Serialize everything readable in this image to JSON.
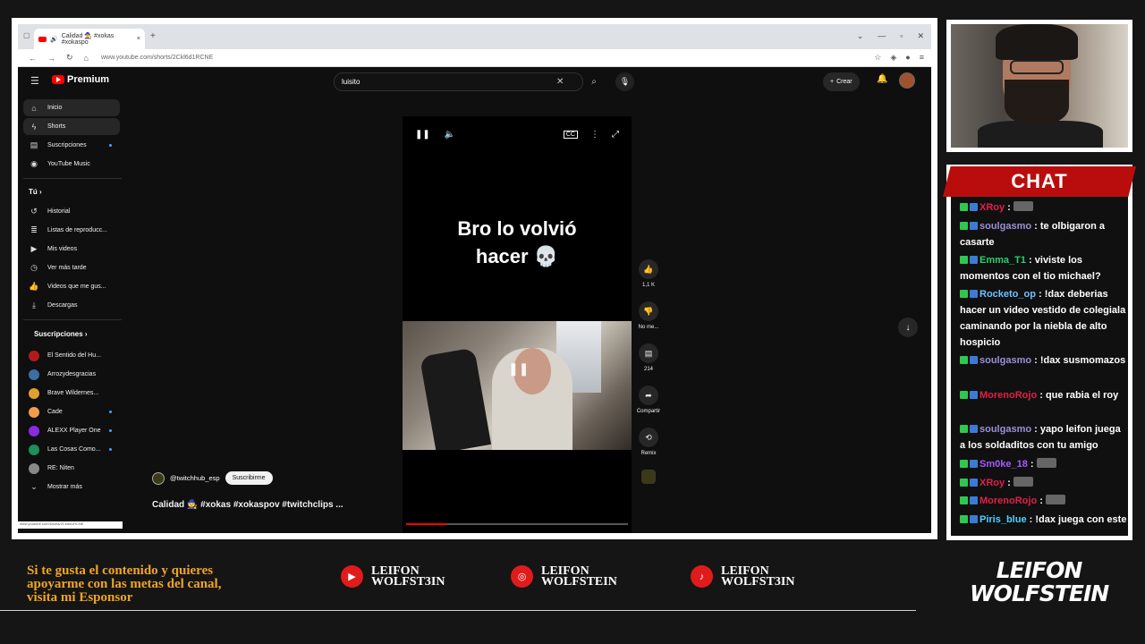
{
  "browser": {
    "tab_title": "Calidad 🧙 #xokas #xokaspo",
    "url": "www.youtube.com/shorts/2Ckl6d1RCNE",
    "close_tab": "×",
    "new_tab": "+"
  },
  "youtube": {
    "logo_text": "Premium",
    "search_value": "luisito",
    "create_label": "Crear",
    "sidebar": {
      "main": [
        {
          "label": "Inicio",
          "icon": "home-icon"
        },
        {
          "label": "Shorts",
          "icon": "shorts-icon"
        },
        {
          "label": "Suscripciones",
          "icon": "subscriptions-icon"
        },
        {
          "label": "YouTube Music",
          "icon": "music-icon"
        }
      ],
      "you_title": "Tú",
      "you": [
        {
          "label": "Historial",
          "icon": "history-icon"
        },
        {
          "label": "Listas de reproducc...",
          "icon": "playlist-icon"
        },
        {
          "label": "Mis videos",
          "icon": "my-videos-icon"
        },
        {
          "label": "Ver más tarde",
          "icon": "watch-later-icon"
        },
        {
          "label": "Videos que me gus...",
          "icon": "like-icon"
        },
        {
          "label": "Descargas",
          "icon": "download-icon"
        }
      ],
      "subs_title": "Suscripciones",
      "subs": [
        {
          "label": "El Sentido del Hu...",
          "color": "#b31b1b"
        },
        {
          "label": "Arrozydesgracias",
          "color": "#3a6ea5"
        },
        {
          "label": "Brave Wildernes...",
          "color": "#e0a030"
        },
        {
          "label": "Cade",
          "color": "#f29d4b"
        },
        {
          "label": "ALEXX Player One",
          "color": "#8a2be2"
        },
        {
          "label": "Las Cosas Como...",
          "color": "#1d8f5a"
        },
        {
          "label": "RE: Niten",
          "color": "#888888"
        }
      ],
      "show_more": "Mostrar más"
    },
    "short": {
      "caption": "Bro lo volvió hacer",
      "caption_line1": "Bro lo volvió",
      "caption_line2": "hacer",
      "channel": "@twitchhub_esp",
      "subscribe": "Suscribirme",
      "title": "Calidad 🧙 #xokas #xokaspov #twitchclips ...",
      "progress": 0.18,
      "likes": "1,1 K",
      "dislike": "No me...",
      "comments": "214",
      "share": "Compartir",
      "remix": "Remix"
    },
    "status_url": "www.youtube.com/shorts/2Ckl6d1RCNE"
  },
  "overlay": {
    "chat_title": "CHAT",
    "chat": [
      {
        "user": "XRoy",
        "color": "#e0204a",
        "text": "",
        "emote": true
      },
      {
        "user": "soulgasmo",
        "color": "#9b8fd8",
        "text": "te olbigaron a casarte"
      },
      {
        "user": "Emma_T1",
        "color": "#28d06a",
        "text": "viviste los momentos con el tio michael?"
      },
      {
        "user": "Rocketo_op",
        "color": "#6fc2ff",
        "text": "!dax deberias hacer un video vestido de colegiala caminando por la niebla de alto hospicio"
      },
      {
        "user": "soulgasmo",
        "color": "#9b8fd8",
        "text": "!dax susmomazos"
      },
      {
        "user": "MorenoRojo",
        "color": "#e0204a",
        "text": "que rabia el roy"
      },
      {
        "user": "soulgasmo",
        "color": "#9b8fd8",
        "text": "yapo leifon juega a los soldaditos con tu amigo"
      },
      {
        "user": "Sm0ke_18",
        "color": "#a45bff",
        "text": "",
        "emote": true
      },
      {
        "user": "XRoy",
        "color": "#e0204a",
        "text": "",
        "emote": true
      },
      {
        "user": "MorenoRojo",
        "color": "#e0204a",
        "text": "",
        "emote": true
      },
      {
        "user": "Piris_blue",
        "color": "#4fd1ff",
        "text": "!dax juega con este"
      }
    ],
    "sponsor_lines": [
      "Si te gusta el contenido y quieres",
      "apoyarme con las metas del canal,",
      "visita mi Esponsor"
    ],
    "socials": [
      {
        "icon": "youtube-icon",
        "line1": "LEIFON",
        "line2": "WOLFST3IN"
      },
      {
        "icon": "instagram-icon",
        "line1": "LEIFON",
        "line2": "WOLFSTEIN"
      },
      {
        "icon": "tiktok-icon",
        "line1": "LEIFON",
        "line2": "WOLFST3IN"
      }
    ],
    "brand_line1": "LEIFON",
    "brand_line2": "WOLFSTEIN"
  },
  "colors": {
    "accent": "#ff0000",
    "chat_header": "#b90d0d",
    "sponsor_text": "#f0a526"
  }
}
